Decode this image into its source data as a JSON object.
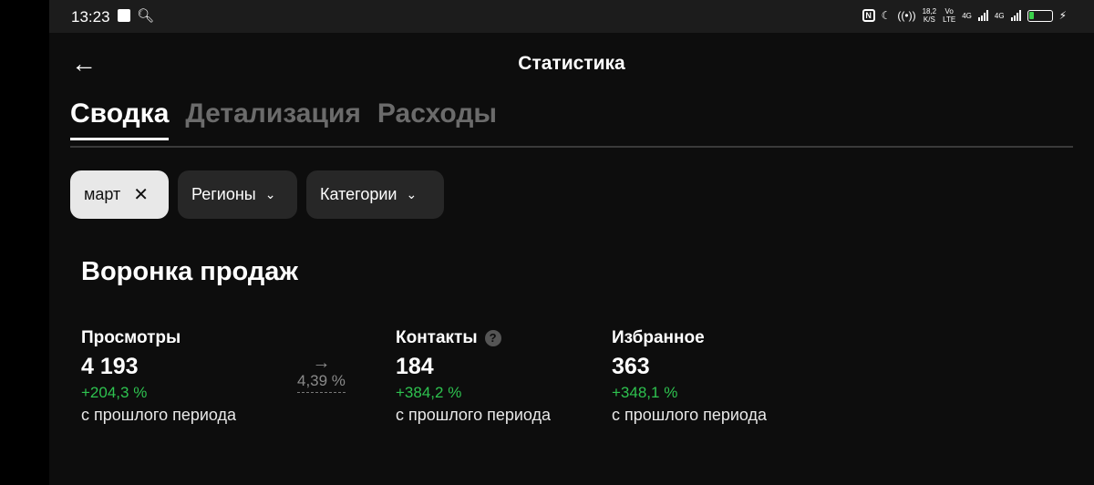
{
  "status_bar": {
    "time": "13:23",
    "speed": "18,2",
    "speed_unit": "K/S",
    "volte_top": "Vo",
    "volte_bottom": "LTE",
    "net1": "4G",
    "net2": "4G"
  },
  "header": {
    "title": "Статистика"
  },
  "tabs": [
    {
      "label": "Сводка",
      "active": true
    },
    {
      "label": "Детализация",
      "active": false
    },
    {
      "label": "Расходы",
      "active": false
    }
  ],
  "filters": {
    "period": {
      "label": "март"
    },
    "regions": {
      "label": "Регионы"
    },
    "categories": {
      "label": "Категории"
    }
  },
  "funnel": {
    "title": "Воронка продаж",
    "conversion": "4,39 %",
    "metrics": [
      {
        "label": "Просмотры",
        "value": "4 193",
        "change": "+204,3 %",
        "note": "с прошлого периода"
      },
      {
        "label": "Контакты",
        "value": "184",
        "change": "+384,2 %",
        "note": "с прошлого периода"
      },
      {
        "label": "Избранное",
        "value": "363",
        "change": "+348,1 %",
        "note": "с прошлого периода"
      }
    ]
  },
  "colors": {
    "positive": "#2ec24f",
    "background": "#0d0d0d",
    "chip_selected": "#e8e8e8"
  }
}
